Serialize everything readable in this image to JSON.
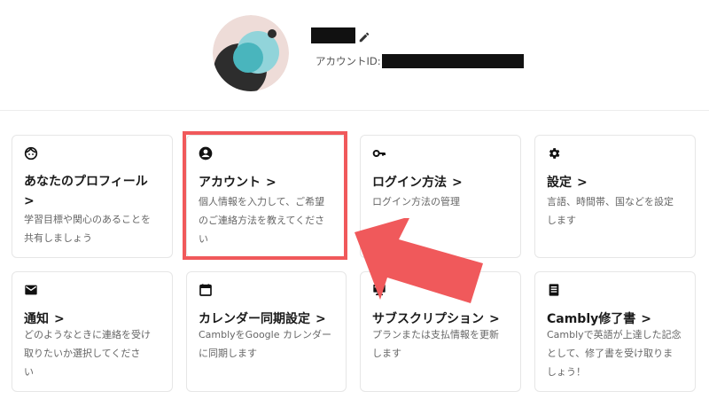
{
  "profile": {
    "account_id_label": "アカウントID:",
    "colors": {
      "avatar_bg": "#eedcd8",
      "avatar_teal": "#49b5bd",
      "avatar_light": "#91d4da",
      "avatar_dark": "#2d2d2d"
    }
  },
  "cards": [
    {
      "id": "profile",
      "icon": "smiley-face-icon",
      "title": "あなたのプロフィール",
      "desc_lines": [
        "学習目標や関心のあることを",
        "共有しましょう"
      ]
    },
    {
      "id": "account",
      "icon": "account-circle-icon",
      "title": "アカウント",
      "desc_lines": [
        "個人情報を入力して、ご希望",
        "のご連絡方法を教えてくださ",
        "い"
      ]
    },
    {
      "id": "login",
      "icon": "key-icon",
      "title": "ログイン方法",
      "desc_lines": [
        "ログイン方法の管理"
      ]
    },
    {
      "id": "settings",
      "icon": "gear-icon",
      "title": "設定",
      "desc_lines": [
        "言語、時間帯、国などを設定",
        "します"
      ]
    },
    {
      "id": "notifications",
      "icon": "mail-icon",
      "title": "通知",
      "desc_lines": [
        "どのようなときに連絡を受け",
        "取りたいか選択してくださ",
        "い"
      ]
    },
    {
      "id": "calendar",
      "icon": "calendar-icon",
      "title": "カレンダー同期設定",
      "desc_lines": [
        "CamblyをGoogle カレンダー",
        "に同期します"
      ]
    },
    {
      "id": "subscription",
      "icon": "subscription-icon",
      "title": "サブスクリプション",
      "desc_lines": [
        "プランまたは支払情報を更新",
        "します"
      ]
    },
    {
      "id": "certificate",
      "icon": "document-icon",
      "title": "Cambly修了書",
      "desc_lines": [
        "Camblyで英語が上達した記念",
        "として、修了書を受け取りま",
        "しょう！"
      ]
    }
  ],
  "chevron": ">",
  "highlight": {
    "target": "account",
    "color": "#f0595b"
  }
}
